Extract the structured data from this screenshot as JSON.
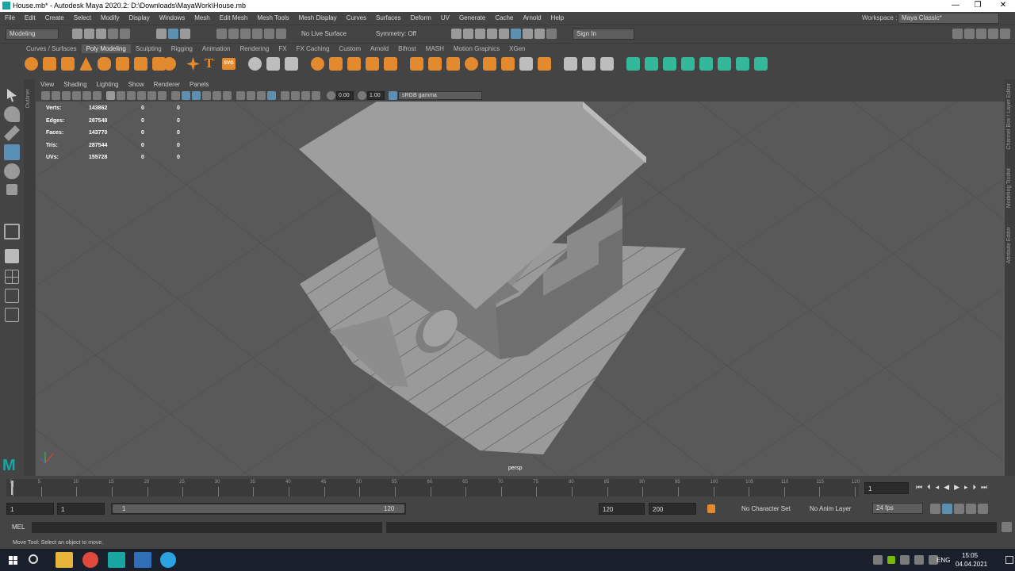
{
  "titlebar": {
    "title": "House.mb* - Autodesk Maya 2020.2: D:\\Downloads\\MayaWork\\House.mb",
    "minimize_glyph": "—",
    "maximize_glyph": "❐",
    "close_glyph": "✕"
  },
  "menubar": {
    "items": [
      "File",
      "Edit",
      "Create",
      "Select",
      "Modify",
      "Display",
      "Windows",
      "Mesh",
      "Edit Mesh",
      "Mesh Tools",
      "Mesh Display",
      "Curves",
      "Surfaces",
      "Deform",
      "UV",
      "Generate",
      "Cache",
      "Arnold",
      "Help"
    ],
    "workspace_label": "Workspace :",
    "workspace_value": "Maya Classic*"
  },
  "status_line": {
    "mode": "Modeling",
    "live_surface": "No Live Surface",
    "symmetry": "Symmetry: Off",
    "sign_in": "Sign In"
  },
  "shelf": {
    "tabs": [
      "Curves / Surfaces",
      "Poly Modeling",
      "Sculpting",
      "Rigging",
      "Animation",
      "Rendering",
      "FX",
      "FX Caching",
      "Custom",
      "Arnold",
      "Bifrost",
      "MASH",
      "Motion Graphics",
      "XGen"
    ],
    "active_tab": "Poly Modeling",
    "text_tool_glyph": "T",
    "svg_label": "SVG"
  },
  "outliner_label": "Outliner",
  "viewport": {
    "menus": [
      "View",
      "Shading",
      "Lighting",
      "Show",
      "Renderer",
      "Panels"
    ],
    "exposure": "0.00",
    "gamma": "1.00",
    "color_space": "sRGB gamma",
    "camera_label": "persp",
    "hud": [
      {
        "label": "Verts:",
        "v1": "143862",
        "v2": "0",
        "v3": "0"
      },
      {
        "label": "Edges:",
        "v1": "287548",
        "v2": "0",
        "v3": "0"
      },
      {
        "label": "Faces:",
        "v1": "143770",
        "v2": "0",
        "v3": "0"
      },
      {
        "label": "Tris:",
        "v1": "287544",
        "v2": "0",
        "v3": "0"
      },
      {
        "label": "UVs:",
        "v1": "155728",
        "v2": "0",
        "v3": "0"
      }
    ]
  },
  "right_panel": [
    "Channel Box / Layer Editor",
    "Modeling Toolkit",
    "Attribute Editor"
  ],
  "timeline": {
    "ticks": [
      "1",
      "5",
      "10",
      "15",
      "20",
      "25",
      "30",
      "35",
      "40",
      "45",
      "50",
      "55",
      "60",
      "65",
      "70",
      "75",
      "80",
      "85",
      "90",
      "95",
      "100",
      "105",
      "110",
      "115",
      "120"
    ],
    "current_frame": "1"
  },
  "range": {
    "start": "1",
    "playback_start": "1",
    "slider_start": "1",
    "slider_end": "120",
    "playback_end": "120",
    "end": "200",
    "character_set": "No Character Set",
    "anim_layer": "No Anim Layer",
    "fps": "24 fps"
  },
  "command_line": {
    "language": "MEL"
  },
  "help_line": "Move Tool: Select an object to move.",
  "taskbar": {
    "language": "ENG",
    "time": "15:05",
    "date": "04.04.2021"
  }
}
